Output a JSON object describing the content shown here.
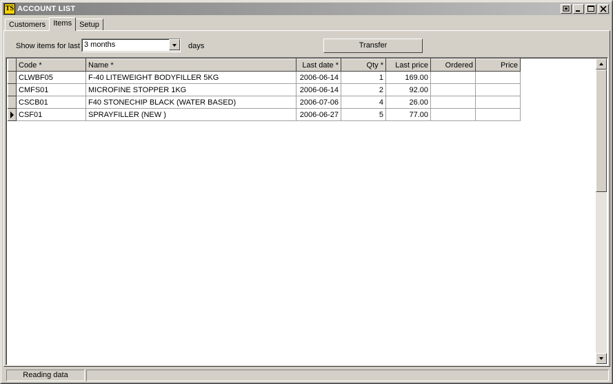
{
  "window": {
    "title": "ACCOUNT LIST",
    "icon_text": "TS",
    "buttons": [
      "restore-special",
      "minimize",
      "maximize",
      "close"
    ]
  },
  "tabs": [
    {
      "label": "Customers",
      "active": false
    },
    {
      "label": "Items",
      "active": true
    },
    {
      "label": "Setup",
      "active": false
    }
  ],
  "toolbar": {
    "show_label": "Show items for last",
    "period_value": "3 months",
    "days_label": "days",
    "transfer_label": "Transfer"
  },
  "grid": {
    "columns": [
      "Code *",
      "Name *",
      "Last date *",
      "Qty *",
      "Last price",
      "Ordered",
      "Price"
    ],
    "rows": [
      {
        "code": "CLWBF05",
        "name": "F-40 LITEWEIGHT BODYFILLER 5KG",
        "last_date": "2006-06-14",
        "qty": "1",
        "last_price": "169.00",
        "ordered": "",
        "price": "",
        "current": false
      },
      {
        "code": "CMFS01",
        "name": "MICROFINE STOPPER 1KG",
        "last_date": "2006-06-14",
        "qty": "2",
        "last_price": "92.00",
        "ordered": "",
        "price": "",
        "current": false
      },
      {
        "code": "CSCB01",
        "name": "F40 STONECHIP BLACK  (WATER BASED)",
        "last_date": "2006-07-06",
        "qty": "4",
        "last_price": "26.00",
        "ordered": "",
        "price": "",
        "current": false
      },
      {
        "code": "CSF01",
        "name": "SPRAYFILLER (NEW )",
        "last_date": "2006-06-27",
        "qty": "5",
        "last_price": "77.00",
        "ordered": "",
        "price": "",
        "current": true
      }
    ]
  },
  "status": {
    "text": "Reading data"
  },
  "colors": {
    "face": "#d4d0c8",
    "title_gradient_start": "#808080",
    "title_gradient_end": "#c0c0c0",
    "icon_bg": "#f7d000"
  }
}
